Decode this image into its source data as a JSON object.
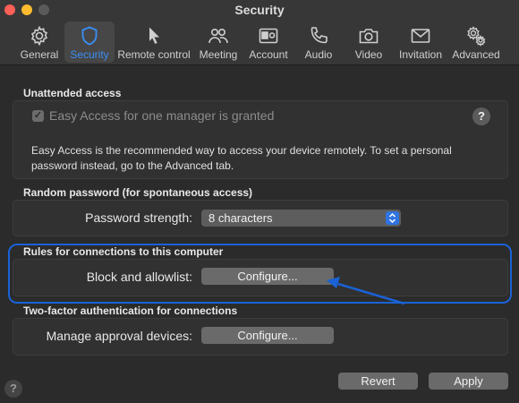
{
  "window": {
    "title": "Security"
  },
  "toolbar": {
    "tabs": [
      {
        "label": "General",
        "icon": "gear-icon"
      },
      {
        "label": "Security",
        "icon": "shield-icon",
        "active": true
      },
      {
        "label": "Remote control",
        "icon": "cursor-icon"
      },
      {
        "label": "Meeting",
        "icon": "people-icon"
      },
      {
        "label": "Account",
        "icon": "id-card-icon"
      },
      {
        "label": "Audio",
        "icon": "phone-icon"
      },
      {
        "label": "Video",
        "icon": "camera-icon"
      },
      {
        "label": "Invitation",
        "icon": "envelope-icon"
      },
      {
        "label": "Advanced",
        "icon": "gears-icon"
      }
    ]
  },
  "unattended": {
    "title": "Unattended access",
    "checkbox_label": "Easy Access for one manager is granted",
    "checked": true,
    "help": "?",
    "description": "Easy Access is the recommended way to access your device remotely. To set a personal password instead, go to the Advanced tab."
  },
  "random_password": {
    "title": "Random password (for spontaneous access)",
    "strength_label": "Password strength:",
    "strength_value": "8 characters"
  },
  "rules": {
    "title": "Rules for connections to this computer",
    "block_label": "Block and allowlist:",
    "configure_label": "Configure..."
  },
  "two_factor": {
    "title": "Two-factor authentication for connections",
    "manage_label": "Manage approval devices:",
    "configure_label": "Configure..."
  },
  "footer": {
    "help": "?",
    "revert_label": "Revert",
    "apply_label": "Apply"
  },
  "colors": {
    "accent": "#3a8ff7",
    "highlight": "#1a62d6",
    "close": "#fe5f57",
    "minimize": "#febc2e"
  }
}
